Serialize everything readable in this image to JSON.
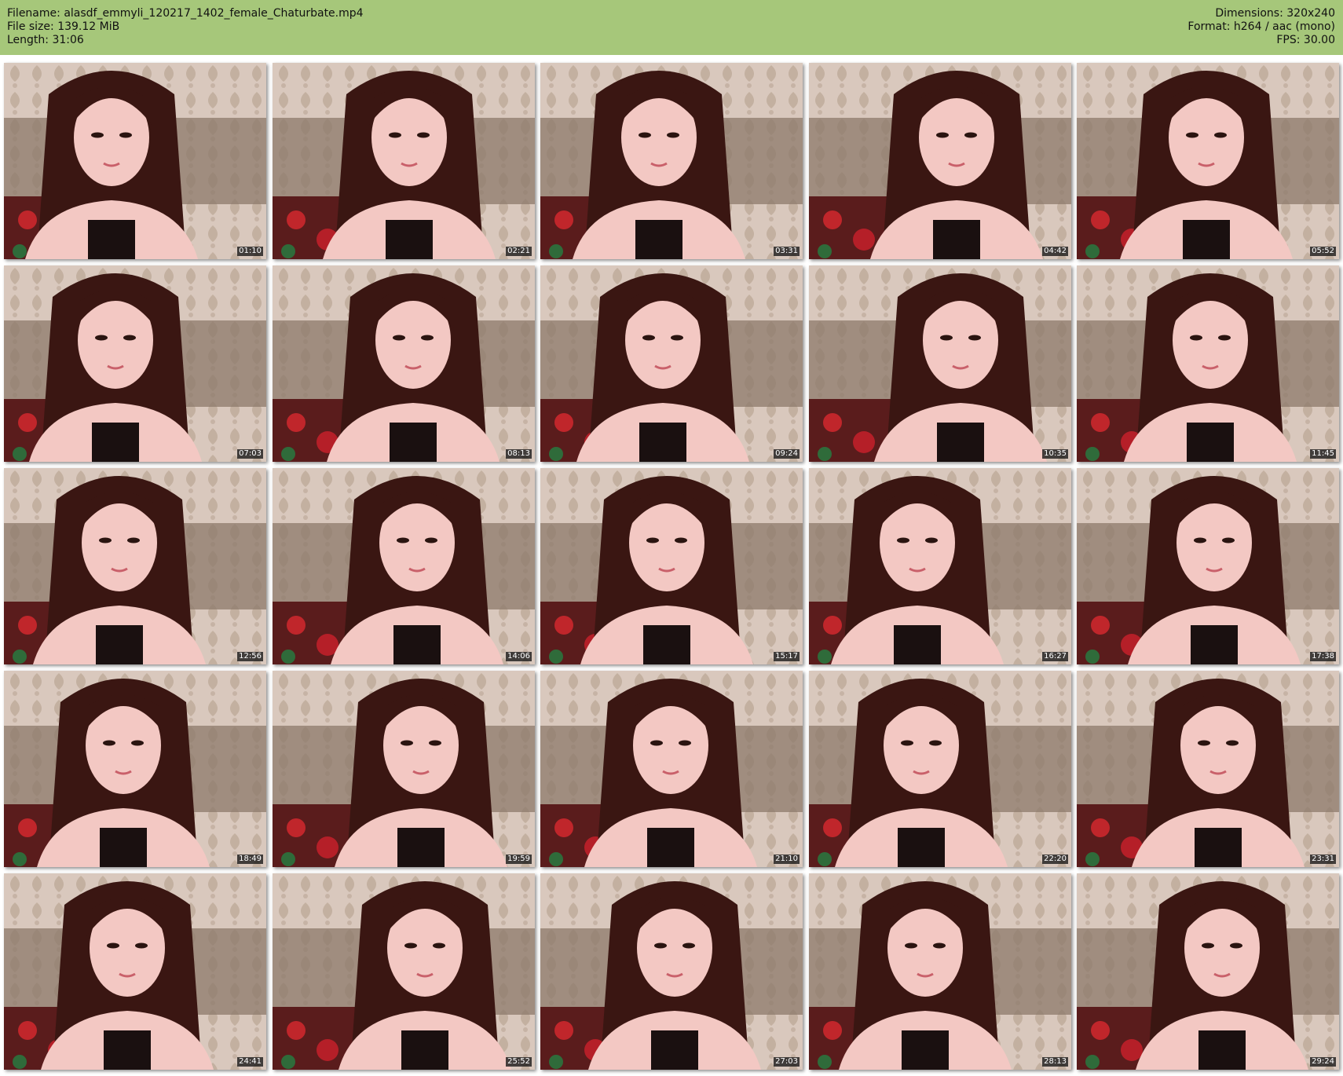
{
  "info": {
    "filename_label": "Filename:",
    "filename": "alasdf_emmyli_120217_1402_female_Chaturbate.mp4",
    "filesize_label": "File size:",
    "filesize": "139.12 MiB",
    "length_label": "Length:",
    "length": "31:06",
    "dimensions_label": "Dimensions:",
    "dimensions": "320x240",
    "format_label": "Format:",
    "format": "h264 / aac (mono)",
    "fps_label": "FPS:",
    "fps": "30.00"
  },
  "colors": {
    "header_bg": "#a6c77a",
    "wallpaper": "#d9c8bd",
    "hair": "#3a1612",
    "skin": "#f3c8c3"
  },
  "thumbnails": [
    {
      "timestamp": "01:10"
    },
    {
      "timestamp": "02:21"
    },
    {
      "timestamp": "03:31"
    },
    {
      "timestamp": "04:42"
    },
    {
      "timestamp": "05:52"
    },
    {
      "timestamp": "07:03"
    },
    {
      "timestamp": "08:13"
    },
    {
      "timestamp": "09:24"
    },
    {
      "timestamp": "10:35"
    },
    {
      "timestamp": "11:45"
    },
    {
      "timestamp": "12:56"
    },
    {
      "timestamp": "14:06"
    },
    {
      "timestamp": "15:17"
    },
    {
      "timestamp": "16:27"
    },
    {
      "timestamp": "17:38"
    },
    {
      "timestamp": "18:49"
    },
    {
      "timestamp": "19:59"
    },
    {
      "timestamp": "21:10"
    },
    {
      "timestamp": "22:20"
    },
    {
      "timestamp": "23:31"
    },
    {
      "timestamp": "24:41"
    },
    {
      "timestamp": "25:52"
    },
    {
      "timestamp": "27:03"
    },
    {
      "timestamp": "28:13"
    },
    {
      "timestamp": "29:24"
    }
  ]
}
